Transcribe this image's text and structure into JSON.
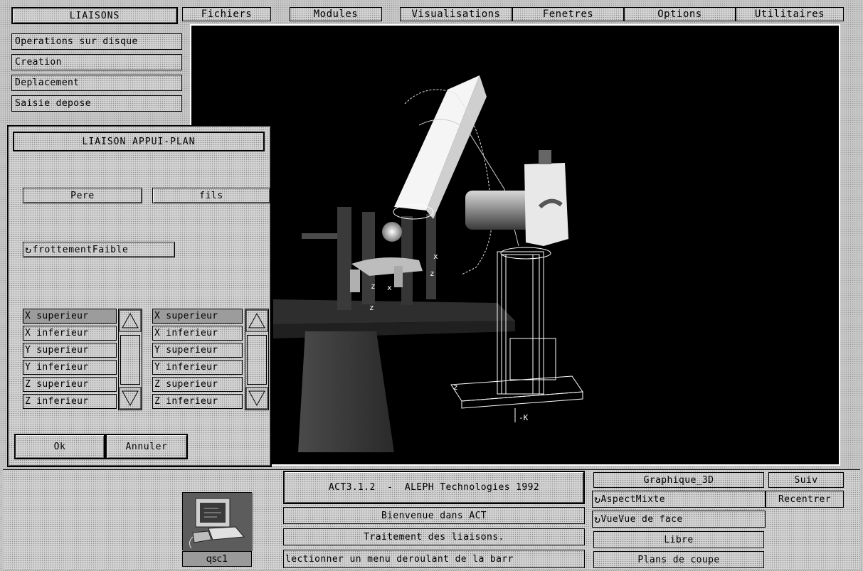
{
  "nav": {
    "title": "LIAISONS",
    "items": [
      {
        "label": "Operations sur disque"
      },
      {
        "label": "Creation"
      },
      {
        "label": "Deplacement"
      },
      {
        "label": "Saisie depose"
      }
    ]
  },
  "menubar": {
    "items": [
      {
        "label": "Fichiers"
      },
      {
        "label": "Modules"
      },
      {
        "label": "Visualisations"
      },
      {
        "label": "Fenetres"
      },
      {
        "label": "Options"
      },
      {
        "label": "Utilitaires"
      }
    ]
  },
  "dialog": {
    "title": "LIAISON APPUI-PLAN",
    "pere_label": "Pere",
    "fils_label": "fils",
    "friction_label": "frottementFaible",
    "list_left": [
      "X superieur",
      "X inferieur",
      "Y superieur",
      "Y inferieur",
      "Z superieur",
      "Z inferieur"
    ],
    "list_right": [
      "X superieur",
      "X inferieur",
      "Y superieur",
      "Y inferieur",
      "Z superieur",
      "Z inferieur"
    ],
    "ok_label": "Ok",
    "cancel_label": "Annuler"
  },
  "viewport": {
    "axis_labels": [
      "z",
      "x",
      "z",
      "x",
      "z",
      "-K",
      "z"
    ]
  },
  "status": {
    "version": "ACT3.1.2  -  ALEPH Technologies 1992",
    "welcome": "Bienvenue dans ACT",
    "task": "Traitement des liaisons.",
    "hint": "lectionner un menu deroulant de la barr",
    "host_label": "qsc1"
  },
  "view_controls": {
    "mode": "Graphique_3D",
    "next_label": "Suiv",
    "aspect": "AspectMixte",
    "recenter_label": "Recentrer",
    "view": "VueVue de face",
    "free_label": "Libre",
    "cut_planes_label": "Plans de coupe"
  },
  "colors": {
    "viewport_bg": "#000000",
    "panel_bg": "#d4d4d4",
    "selected_bg": "#9c9c9c"
  }
}
